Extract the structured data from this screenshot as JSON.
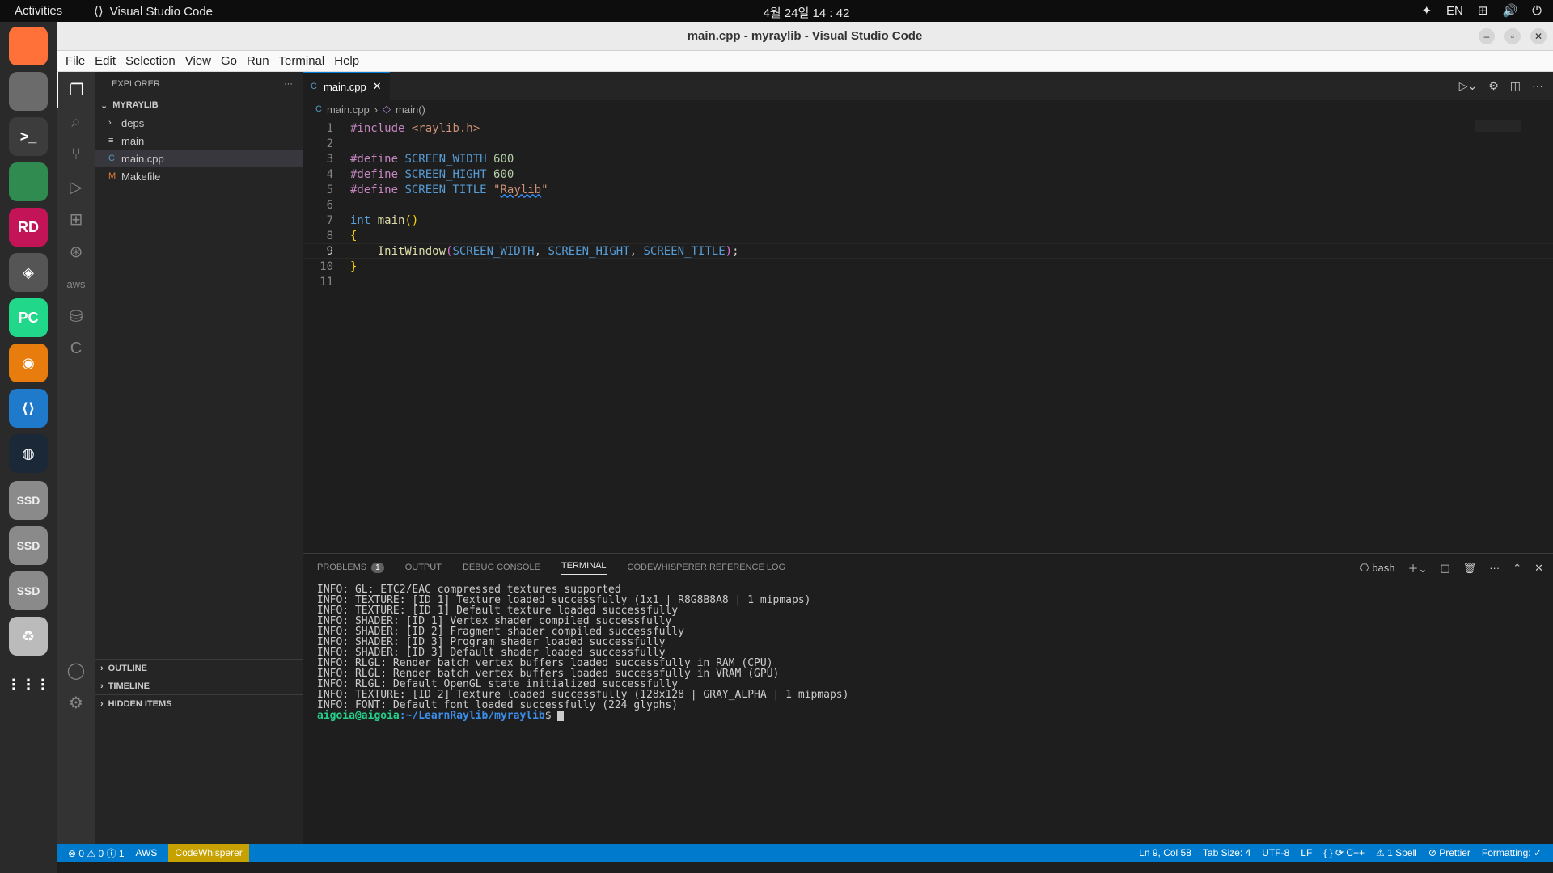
{
  "topbar": {
    "activities": "Activities",
    "app_name": "Visual Studio Code",
    "clock": "4월 24일  14 : 42",
    "lang": "EN"
  },
  "dock": {
    "items": [
      {
        "name": "firefox-icon",
        "label": "",
        "color": "#ff7139"
      },
      {
        "name": "files-icon",
        "label": "",
        "color": "#6b6b6b"
      },
      {
        "name": "terminal-icon",
        "label": ">_",
        "color": "#3c3c3c"
      },
      {
        "name": "chrome-icon",
        "label": "",
        "color": "#2f8b4f"
      },
      {
        "name": "rider-icon",
        "label": "RD",
        "color": "#c21456"
      },
      {
        "name": "unity-icon",
        "label": "◈",
        "color": "#555"
      },
      {
        "name": "pycharm-icon",
        "label": "PC",
        "color": "#21d789"
      },
      {
        "name": "blender-icon",
        "label": "◉",
        "color": "#e87d0d"
      },
      {
        "name": "vscode-icon",
        "label": "⟨⟩",
        "color": "#1f7acc"
      },
      {
        "name": "steam-icon",
        "label": "◍",
        "color": "#1b2838"
      },
      {
        "name": "ssd-drive-icon",
        "label": "SSD",
        "color": "#8a8a8a"
      },
      {
        "name": "ssd-drive-icon",
        "label": "SSD",
        "color": "#8a8a8a"
      },
      {
        "name": "ssd-drive-icon",
        "label": "SSD",
        "color": "#8a8a8a"
      },
      {
        "name": "trash-icon",
        "label": "♻",
        "color": "#bbbbbb"
      },
      {
        "name": "app-grid-icon",
        "label": "⋮⋮⋮",
        "color": "#2a2a2a"
      }
    ]
  },
  "window": {
    "title": "main.cpp - myraylib - Visual Studio Code"
  },
  "menu": [
    "File",
    "Edit",
    "Selection",
    "View",
    "Go",
    "Run",
    "Terminal",
    "Help"
  ],
  "explorer": {
    "header": "EXPLORER",
    "root": "MYRAYLIB",
    "items": [
      {
        "label": "deps",
        "kind": "folder"
      },
      {
        "label": "main",
        "kind": "file"
      },
      {
        "label": "main.cpp",
        "kind": "cpp",
        "selected": true
      },
      {
        "label": "Makefile",
        "kind": "makefile"
      }
    ],
    "sections": [
      "OUTLINE",
      "TIMELINE",
      "HIDDEN ITEMS"
    ]
  },
  "editor": {
    "tab": "main.cpp",
    "breadcrumb": [
      "main.cpp",
      "main()"
    ],
    "current_line": 9
  },
  "panel": {
    "tabs": [
      "PROBLEMS",
      "OUTPUT",
      "DEBUG CONSOLE",
      "TERMINAL",
      "CODEWHISPERER REFERENCE LOG"
    ],
    "problems_count": "1",
    "active": "TERMINAL",
    "shell": "bash",
    "lines": [
      "INFO: GL: ETC2/EAC compressed textures supported",
      "INFO: TEXTURE: [ID 1] Texture loaded successfully (1x1 | R8G8B8A8 | 1 mipmaps)",
      "INFO: TEXTURE: [ID 1] Default texture loaded successfully",
      "INFO: SHADER: [ID 1] Vertex shader compiled successfully",
      "INFO: SHADER: [ID 2] Fragment shader compiled successfully",
      "INFO: SHADER: [ID 3] Program shader loaded successfully",
      "INFO: SHADER: [ID 3] Default shader loaded successfully",
      "INFO: RLGL: Render batch vertex buffers loaded successfully in RAM (CPU)",
      "INFO: RLGL: Render batch vertex buffers loaded successfully in VRAM (GPU)",
      "INFO: RLGL: Default OpenGL state initialized successfully",
      "INFO: TEXTURE: [ID 2] Texture loaded successfully (128x128 | GRAY_ALPHA | 1 mipmaps)",
      "INFO: FONT: Default font loaded successfully (224 glyphs)"
    ],
    "prompt_user": "aigoia@aigoia",
    "prompt_path": ":~/LearnRaylib/myraylib",
    "prompt_end": "$ "
  },
  "status": {
    "errors": "⊗ 0 ⚠ 0 ⓘ 1",
    "aws": "AWS",
    "codewhisperer": "CodeWhisperer",
    "right": [
      "Ln 9, Col 58",
      "Tab Size: 4",
      "UTF-8",
      "LF",
      "{ } ⟳ C++",
      "⚠ 1 Spell",
      "⊘ Prettier",
      "Formatting: ✓"
    ]
  }
}
